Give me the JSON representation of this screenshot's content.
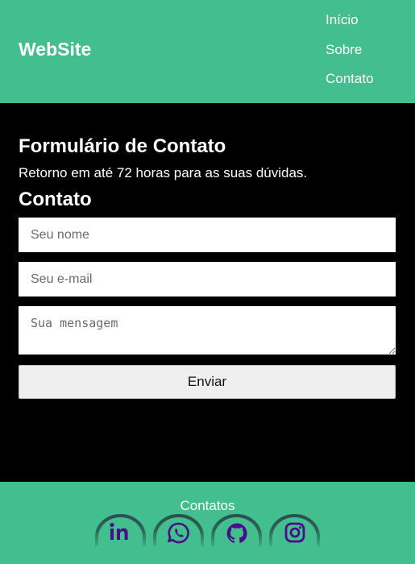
{
  "header": {
    "logo": "WebSite",
    "nav": [
      {
        "label": "Início"
      },
      {
        "label": "Sobre"
      },
      {
        "label": "Contato"
      }
    ]
  },
  "main": {
    "title": "Formulário de Contato",
    "subtitle": "Retorno em até 72 horas para as suas dúvidas.",
    "form": {
      "heading": "Contato",
      "name_placeholder": "Seu nome",
      "email_placeholder": "Seu e-mail",
      "message_placeholder": "Sua mensagem",
      "submit_label": "Enviar"
    }
  },
  "footer": {
    "title": "Contatos",
    "social": [
      {
        "icon": "linkedin-icon"
      },
      {
        "icon": "whatsapp-icon"
      },
      {
        "icon": "github-icon"
      },
      {
        "icon": "instagram-icon"
      }
    ]
  },
  "colors": {
    "brand_green": "#43bf8f",
    "icon_purple": "#4a0d8a",
    "background": "#000000"
  }
}
